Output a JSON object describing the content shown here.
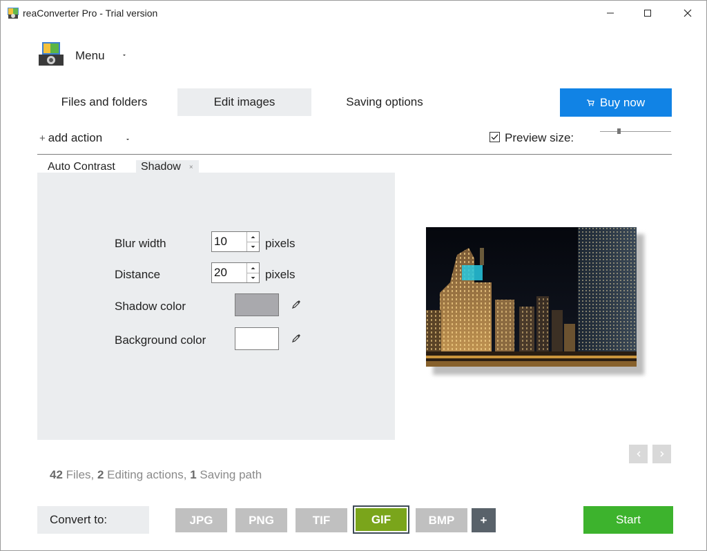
{
  "window": {
    "title": "reaConverter Pro - Trial version"
  },
  "menu": {
    "label": "Menu"
  },
  "tabs": [
    {
      "label": "Files and folders"
    },
    {
      "label": "Edit images"
    },
    {
      "label": "Saving options"
    }
  ],
  "buy": {
    "label": "Buy now"
  },
  "actions": {
    "add_label": "add action",
    "preview_label": "Preview size:",
    "preview_checked": true
  },
  "action_tabs": [
    {
      "label": "Auto Contrast"
    },
    {
      "label": "Shadow"
    }
  ],
  "shadow": {
    "blur_label": "Blur width",
    "blur_value": "10",
    "blur_unit": "pixels",
    "distance_label": "Distance",
    "distance_value": "20",
    "distance_unit": "pixels",
    "shadow_color_label": "Shadow color",
    "shadow_color": "#a9a9ad",
    "bg_color_label": "Background color",
    "bg_color": "#ffffff"
  },
  "summary": {
    "files_count": "42",
    "files_text": " Files, ",
    "actions_count": "2",
    "actions_text": " Editing actions, ",
    "paths_count": "1",
    "paths_text": " Saving path"
  },
  "convert": {
    "label": "Convert to:",
    "formats": [
      "JPG",
      "PNG",
      "TIF",
      "GIF",
      "BMP"
    ],
    "selected": "GIF",
    "add_label": "+",
    "start_label": "Start"
  },
  "colors": {
    "accent_blue": "#1183e5",
    "start_green": "#3db32d",
    "gif_green": "#7aa51b"
  }
}
